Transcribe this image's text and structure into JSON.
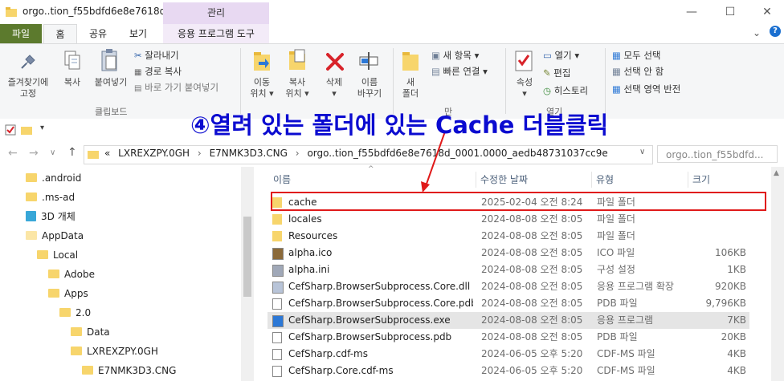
{
  "window": {
    "title": "orgo..tion_f55bdfd6e8e7618d_...",
    "context_header": "관리"
  },
  "tabs": {
    "file": "파일",
    "home": "홈",
    "share": "공유",
    "view": "보기",
    "app_tools": "응용 프로그램 도구"
  },
  "ribbon": {
    "pin": "즐겨찾기에\n고정",
    "copy": "복사",
    "paste": "붙여넣기",
    "cut": "잘라내기",
    "copy_path": "경로 복사",
    "paste_shortcut": "바로 가기 붙여넣기",
    "clipboard_group": "클립보드",
    "move_to": "이동\n위치 ▾",
    "copy_to": "복사\n위치 ▾",
    "delete": "삭제\n▾",
    "rename": "이름\n바꾸기",
    "new_folder": "새\n폴더",
    "new_item": "새 항목 ▾",
    "easy_access": "빠른 연결 ▾",
    "new_group_partial": "만",
    "properties": "속성\n▾",
    "open": "열기 ▾",
    "edit": "편집",
    "history": "히스토리",
    "open_group_partial": "열기",
    "select_all": "모두 선택",
    "select_none": "선택 안 함",
    "invert_selection": "선택 영역 반전"
  },
  "address": {
    "prefix": "«",
    "crumbs": [
      "LXREXZPY.0GH",
      "E7NMK3D3.CNG",
      "orgo..tion_f55bdfd6e8e7618d_0001.0000_aedb48731037cc9e"
    ],
    "search_placeholder": "orgo..tion_f55bdfd..."
  },
  "nav": [
    {
      "label": ".android",
      "indent": 0
    },
    {
      "label": ".ms-ad",
      "indent": 0
    },
    {
      "label": "3D 개체",
      "indent": 0
    },
    {
      "label": "AppData",
      "indent": 0
    },
    {
      "label": "Local",
      "indent": 1
    },
    {
      "label": "Adobe",
      "indent": 2
    },
    {
      "label": "Apps",
      "indent": 2
    },
    {
      "label": "2.0",
      "indent": 3
    },
    {
      "label": "Data",
      "indent": 4
    },
    {
      "label": "LXREXZPY.0GH",
      "indent": 4
    },
    {
      "label": "E7NMK3D3.CNG",
      "indent": 5
    }
  ],
  "columns": {
    "name": "이름",
    "date": "수정한 날짜",
    "type": "유형",
    "size": "크기"
  },
  "files": [
    {
      "name": "cache",
      "date": "2025-02-04 오전 8:24",
      "type": "파일 폴더",
      "size": "",
      "icon": "folder"
    },
    {
      "name": "locales",
      "date": "2024-08-08 오전 8:05",
      "type": "파일 폴더",
      "size": "",
      "icon": "folder"
    },
    {
      "name": "Resources",
      "date": "2024-08-08 오전 8:05",
      "type": "파일 폴더",
      "size": "",
      "icon": "folder"
    },
    {
      "name": "alpha.ico",
      "date": "2024-08-08 오전 8:05",
      "type": "ICO 파일",
      "size": "106KB",
      "icon": "image"
    },
    {
      "name": "alpha.ini",
      "date": "2024-08-08 오전 8:05",
      "type": "구성 설정",
      "size": "1KB",
      "icon": "settings"
    },
    {
      "name": "CefSharp.BrowserSubprocess.Core.dll",
      "date": "2024-08-08 오전 8:05",
      "type": "응용 프로그램 확장",
      "size": "920KB",
      "icon": "dll"
    },
    {
      "name": "CefSharp.BrowserSubprocess.Core.pdb",
      "date": "2024-08-08 오전 8:05",
      "type": "PDB 파일",
      "size": "9,796KB",
      "icon": "doc"
    },
    {
      "name": "CefSharp.BrowserSubprocess.exe",
      "date": "2024-08-08 오전 8:05",
      "type": "응용 프로그램",
      "size": "7KB",
      "icon": "exe"
    },
    {
      "name": "CefSharp.BrowserSubprocess.pdb",
      "date": "2024-08-08 오전 8:05",
      "type": "PDB 파일",
      "size": "20KB",
      "icon": "doc"
    },
    {
      "name": "CefSharp.cdf-ms",
      "date": "2024-06-05 오후 5:20",
      "type": "CDF-MS 파일",
      "size": "4KB",
      "icon": "doc"
    },
    {
      "name": "CefSharp.Core.cdf-ms",
      "date": "2024-06-05 오후 5:20",
      "type": "CDF-MS 파일",
      "size": "4KB",
      "icon": "doc"
    }
  ],
  "callout": "④열려 있는 폴더에 있는 Cache 더블클릭",
  "colors": {
    "accent_purple": "#e8d9f2",
    "file_tab": "#5c7a2d",
    "callout_text": "#0b0bd0",
    "highlight": "#e01a1a",
    "folder": "#f7d56c"
  }
}
